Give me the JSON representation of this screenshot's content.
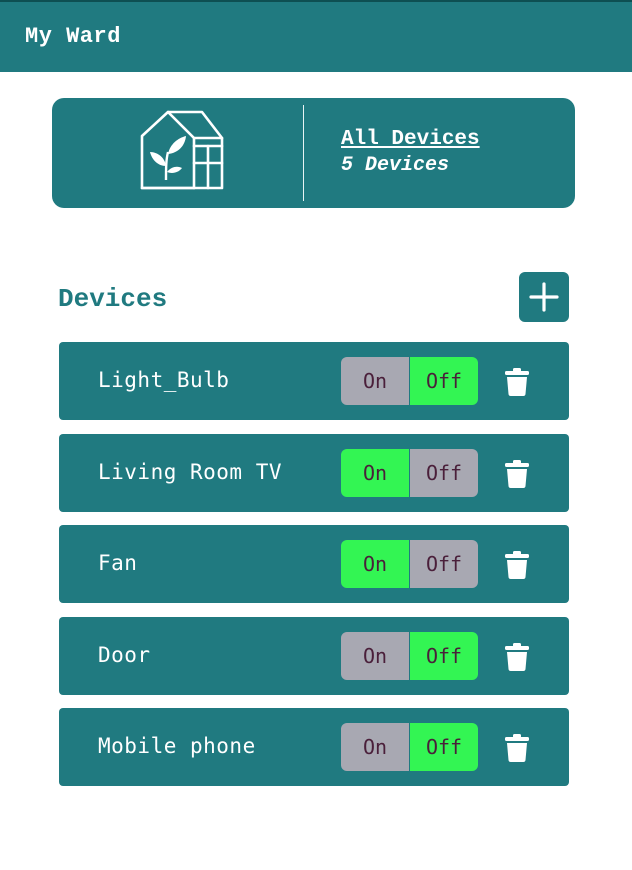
{
  "header": {
    "title": "My Ward"
  },
  "summary": {
    "icon": "greenhouse-plant-icon",
    "link_label": "All Devices",
    "count_label": "5 Devices"
  },
  "devices_section": {
    "title": "Devices",
    "add_icon": "plus-icon",
    "on_label": "On",
    "off_label": "Off",
    "delete_icon": "trash-icon",
    "items": [
      {
        "name": "Light_Bulb",
        "state": "off"
      },
      {
        "name": "Living Room TV",
        "state": "on"
      },
      {
        "name": "Fan",
        "state": "on"
      },
      {
        "name": "Door",
        "state": "off"
      },
      {
        "name": "Mobile phone",
        "state": "off"
      }
    ]
  },
  "colors": {
    "primary": "#207a80",
    "active_toggle": "#33f553",
    "inactive_toggle": "#a8a8b2",
    "toggle_text": "#4a1f3a"
  }
}
